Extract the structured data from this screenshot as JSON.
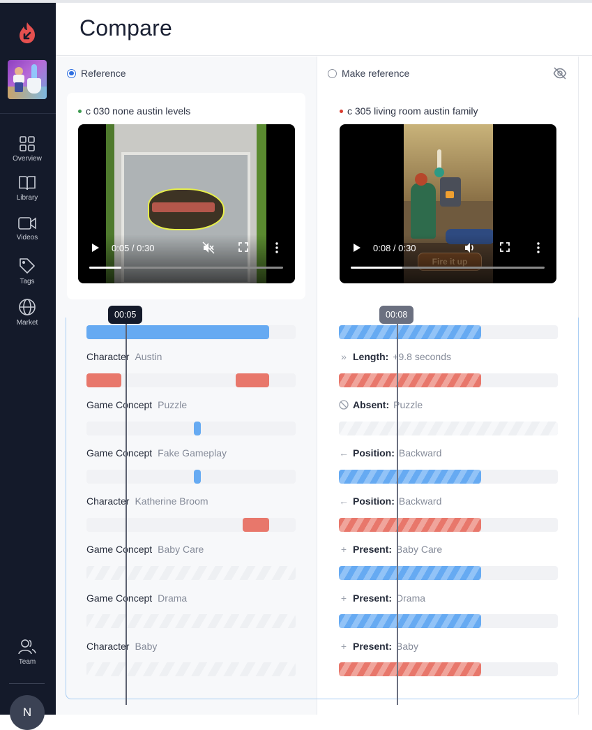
{
  "header": {
    "title": "Compare"
  },
  "sidebar": {
    "logo": "flame-logo-icon",
    "game_thumbnail": "game-app-icon",
    "items": [
      {
        "label": "Overview",
        "icon": "grid-icon"
      },
      {
        "label": "Library",
        "icon": "book-icon"
      },
      {
        "label": "Videos",
        "icon": "video-camera-icon"
      },
      {
        "label": "Tags",
        "icon": "tag-icon"
      },
      {
        "label": "Market",
        "icon": "globe-icon"
      }
    ],
    "bottom_items": [
      {
        "label": "Team",
        "icon": "users-icon"
      }
    ],
    "avatar_initial": "N"
  },
  "left_panel": {
    "radio_label": "Reference",
    "radio_checked": true,
    "video": {
      "title": "c 030 none austin levels",
      "status_color": "#3d9a4f",
      "current_time": "0:05",
      "duration": "0:30",
      "time_display": "0:05 / 0:30",
      "progress": 0.167,
      "muted": true
    },
    "playhead_label": "00:05",
    "rows": [
      {
        "category": "",
        "value": "",
        "segments": [
          {
            "start": 0.0,
            "end": 0.873,
            "color": "blue"
          }
        ]
      },
      {
        "category": "Character",
        "value": "Austin",
        "segments": [
          {
            "start": 0.0,
            "end": 0.167,
            "color": "red"
          },
          {
            "start": 0.713,
            "end": 0.873,
            "color": "red"
          }
        ]
      },
      {
        "category": "Game Concept",
        "value": "Puzzle",
        "segments": [
          {
            "start": 0.513,
            "end": 0.547,
            "color": "blue"
          }
        ]
      },
      {
        "category": "Game Concept",
        "value": "Fake Gameplay",
        "segments": [
          {
            "start": 0.513,
            "end": 0.547,
            "color": "blue"
          }
        ]
      },
      {
        "category": "Character",
        "value": "Katherine Broom",
        "segments": [
          {
            "start": 0.747,
            "end": 0.873,
            "color": "red"
          }
        ]
      },
      {
        "category": "Game Concept",
        "value": "Baby Care",
        "segments": [],
        "absent": true
      },
      {
        "category": "Game Concept",
        "value": "Drama",
        "segments": [],
        "absent": true
      },
      {
        "category": "Character",
        "value": "Baby",
        "segments": [],
        "absent": true
      }
    ]
  },
  "right_panel": {
    "radio_label": "Make reference",
    "radio_checked": false,
    "hide_icon": "eye-off-icon",
    "video": {
      "title": "c 305 living room austin family",
      "status_color": "#d93b2e",
      "current_time": "0:08",
      "duration": "0:30",
      "time_display": "0:08 / 0:30",
      "progress": 0.267,
      "muted": false,
      "overlay_button": "Fire it up"
    },
    "playhead_label": "00:08",
    "rows": [
      {
        "icon": "",
        "key": "",
        "value": "",
        "segments": [
          {
            "start": 0.0,
            "end": 0.65,
            "color": "blue-striped"
          }
        ]
      },
      {
        "icon": "chevrons-right-icon",
        "key": "Length:",
        "value": "+9.8 seconds",
        "segments": [
          {
            "start": 0.0,
            "end": 0.65,
            "color": "red-striped"
          }
        ]
      },
      {
        "icon": "ban-icon",
        "key": "Absent:",
        "value": "Puzzle",
        "segments": [],
        "absent": true
      },
      {
        "icon": "arrow-left-icon",
        "key": "Position:",
        "value": "Backward",
        "segments": [
          {
            "start": 0.0,
            "end": 0.65,
            "color": "blue-striped"
          }
        ]
      },
      {
        "icon": "arrow-left-icon",
        "key": "Position:",
        "value": "Backward",
        "segments": [
          {
            "start": 0.0,
            "end": 0.65,
            "color": "red-striped"
          }
        ]
      },
      {
        "icon": "plus-icon",
        "key": "Present:",
        "value": "Baby Care",
        "segments": [
          {
            "start": 0.0,
            "end": 0.65,
            "color": "blue-striped"
          }
        ]
      },
      {
        "icon": "plus-icon",
        "key": "Present:",
        "value": "Drama",
        "segments": [
          {
            "start": 0.0,
            "end": 0.65,
            "color": "blue-striped"
          }
        ]
      },
      {
        "icon": "plus-icon",
        "key": "Present:",
        "value": "Baby",
        "segments": [
          {
            "start": 0.0,
            "end": 0.65,
            "color": "red-striped"
          }
        ]
      }
    ]
  },
  "colors": {
    "sidebar_bg": "#141a2a",
    "accent_blue": "#66aaf2",
    "accent_red": "#e8776b",
    "radio_blue": "#2f6fe0",
    "timeline_border": "#a8cdf3"
  }
}
